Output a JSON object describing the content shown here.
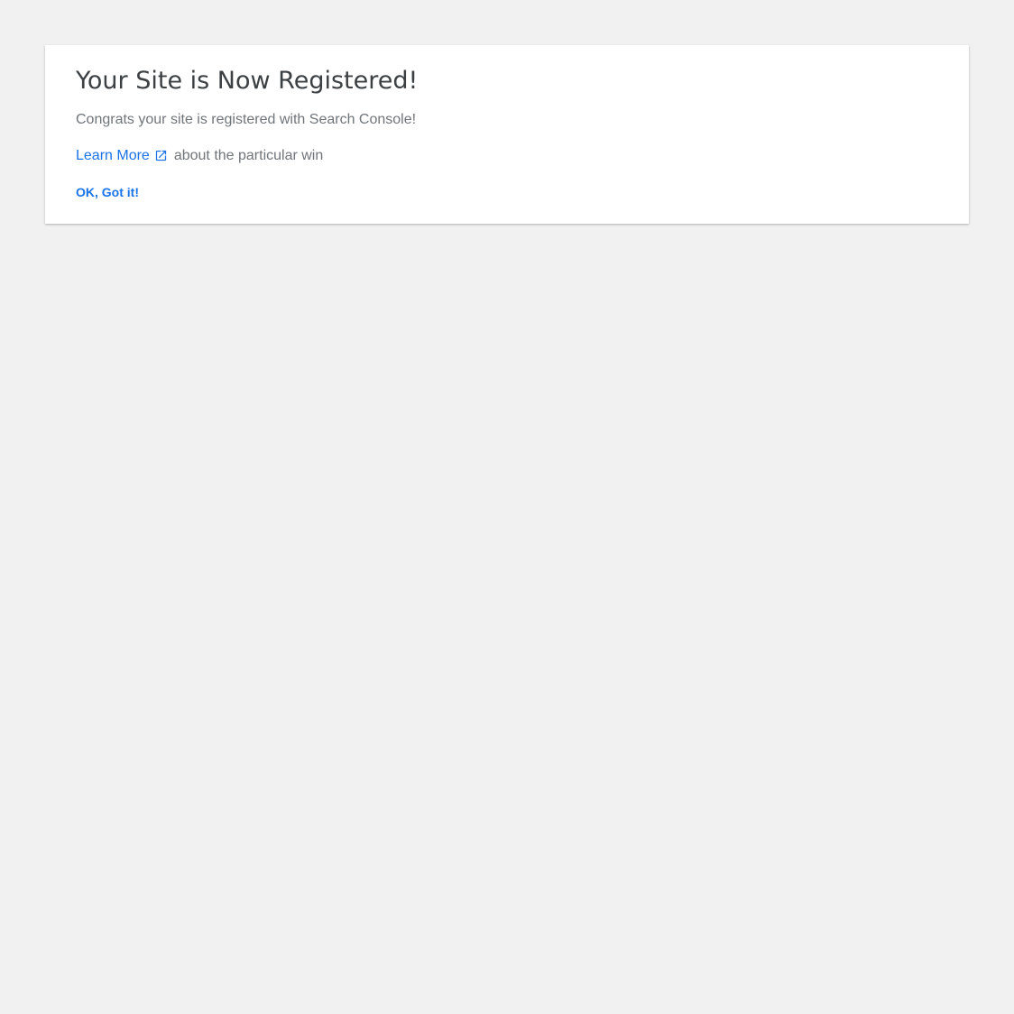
{
  "card": {
    "title": "Your Site is Now Registered!",
    "message": "Congrats your site is registered with Search Console!",
    "learn_more_label": "Learn More",
    "learn_more_icon": "external-link-icon",
    "learn_more_suffix": "about the particular win",
    "ok_label": "OK, Got it!"
  },
  "colors": {
    "page_background": "#f1f1f1",
    "card_background": "#ffffff",
    "title_text": "#3c4043",
    "body_text": "#70757a",
    "link_accent": "#1a73e8"
  }
}
